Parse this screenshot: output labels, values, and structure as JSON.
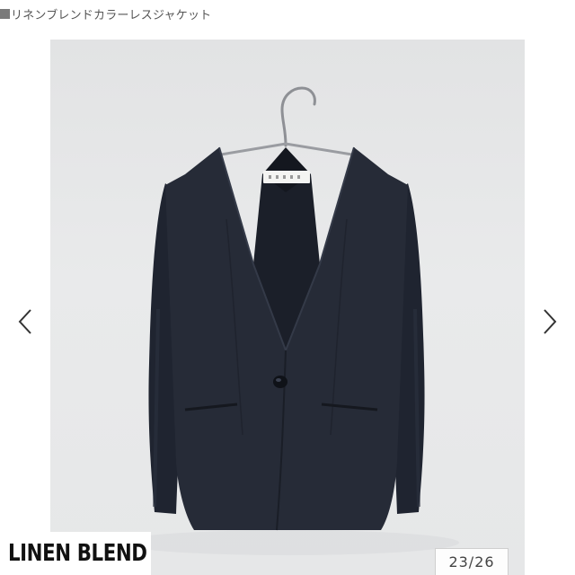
{
  "product": {
    "title_marker": "■",
    "title": "リネンブレンドカラーレスジャケット"
  },
  "gallery": {
    "badge_text": "LINEN BLEND",
    "counter_text": "23/26",
    "current_index": 23,
    "total_images": 26,
    "prev_icon": "chevron-left-icon",
    "next_icon": "chevron-right-icon",
    "image_subject": "navy collarless jacket on hanger",
    "colors": {
      "backdrop": "#e6e7e8",
      "jacket": "#252a36",
      "arrow": "#333333"
    }
  }
}
